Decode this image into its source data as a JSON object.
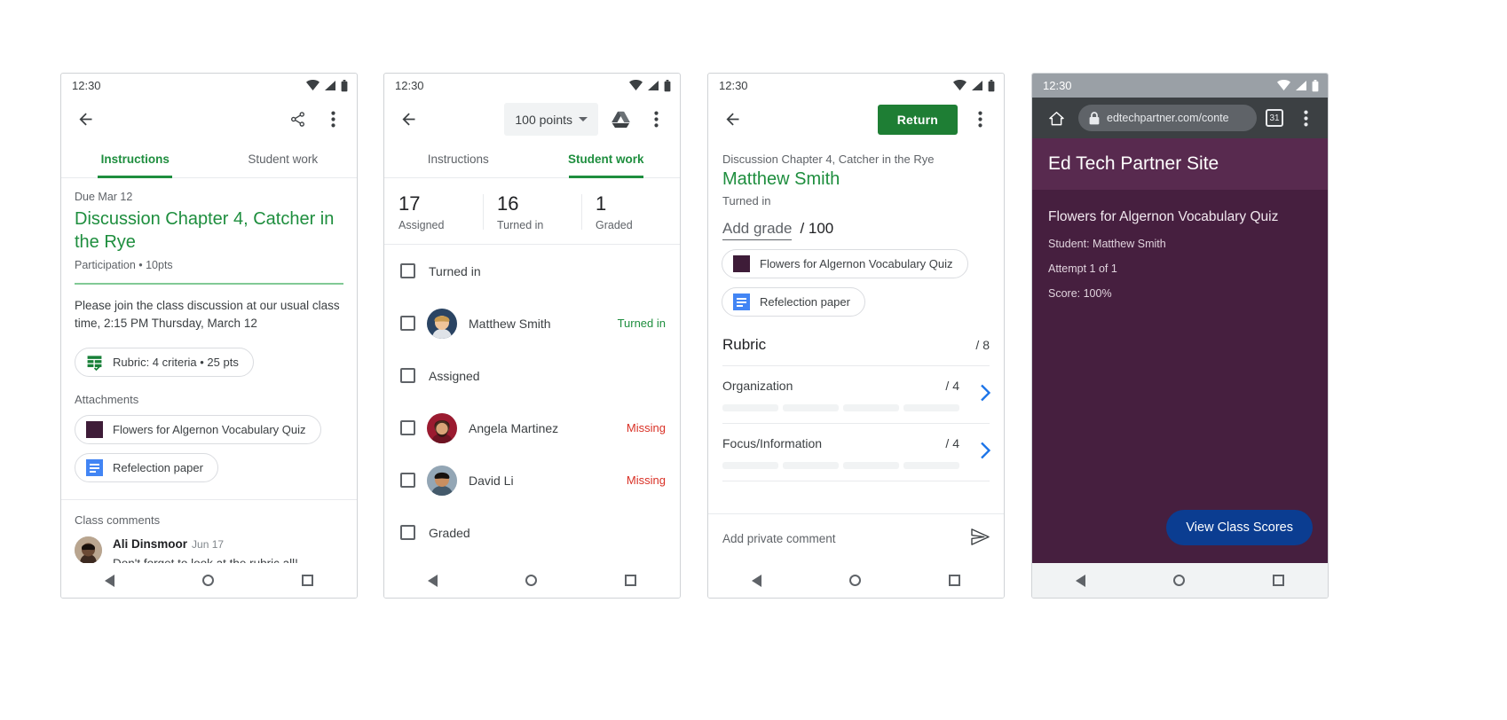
{
  "colors": {
    "green": "#1e8e3e",
    "return_green": "#1e7e34",
    "red": "#d93025",
    "blue_chevron": "#1a73e8",
    "site_purple": "#461f3f",
    "site_header_purple": "#582a4f",
    "button_blue": "#0b3d91",
    "attachment_swatch": "#3e1c38",
    "doc_blue": "#4285f4"
  },
  "status_bar": {
    "time": "12:30"
  },
  "nav_bar": {
    "back": "back-triangle",
    "home": "home-circle",
    "recents": "recents-square"
  },
  "phone1": {
    "appbar": {
      "back_icon": "arrow-back-icon",
      "share_icon": "share-icon",
      "more_icon": "more-vert-icon"
    },
    "tabs": [
      {
        "label": "Instructions",
        "active": true
      },
      {
        "label": "Student work",
        "active": false
      }
    ],
    "due": "Due Mar 12",
    "title": "Discussion Chapter 4, Catcher in the Rye",
    "subtitle": "Participation • 10pts",
    "description": "Please join the class discussion at our usual class time, 2:15 PM Thursday, March 12",
    "rubric_chip": "Rubric: 4 criteria • 25 pts",
    "attachments_label": "Attachments",
    "attachments": [
      {
        "label": "Flowers for Algernon Vocabulary Quiz",
        "icon": "purple-swatch-icon"
      },
      {
        "label": "Refelection paper",
        "icon": "google-docs-icon"
      }
    ],
    "class_comments_label": "Class comments",
    "comment": {
      "author": "Ali Dinsmoor",
      "date": "Jun 17",
      "text": "Don't forget to look at the rubric all!"
    }
  },
  "phone2": {
    "appbar": {
      "back_icon": "arrow-back-icon",
      "points": "100 points",
      "drive_icon": "google-drive-icon",
      "more_icon": "more-vert-icon"
    },
    "tabs": [
      {
        "label": "Instructions",
        "active": false
      },
      {
        "label": "Student work",
        "active": true
      }
    ],
    "stats": [
      {
        "number": "17",
        "label": "Assigned"
      },
      {
        "number": "16",
        "label": "Turned in"
      },
      {
        "number": "1",
        "label": "Graded"
      }
    ],
    "rows": [
      {
        "type": "group",
        "label": "Turned in"
      },
      {
        "type": "student",
        "name": "Matthew Smith",
        "status": "Turned in",
        "status_kind": "turned"
      },
      {
        "type": "group",
        "label": "Assigned"
      },
      {
        "type": "student",
        "name": "Angela Martinez",
        "status": "Missing",
        "status_kind": "missing"
      },
      {
        "type": "student",
        "name": "David Li",
        "status": "Missing",
        "status_kind": "missing"
      },
      {
        "type": "group",
        "label": "Graded"
      }
    ]
  },
  "phone3": {
    "appbar": {
      "back_icon": "arrow-back-icon",
      "return_label": "Return",
      "more_icon": "more-vert-icon"
    },
    "assignment": "Discussion Chapter 4, Catcher in the Rye",
    "student": "Matthew Smith",
    "state": "Turned in",
    "grade_placeholder": "Add grade",
    "grade_max": "/ 100",
    "attachments": [
      {
        "label": "Flowers for Algernon Vocabulary Quiz",
        "icon": "purple-swatch-icon"
      },
      {
        "label": "Refelection paper",
        "icon": "google-docs-icon"
      }
    ],
    "rubric": {
      "title": "Rubric",
      "total": "/ 8",
      "criteria": [
        {
          "name": "Organization",
          "points": "/ 4",
          "levels": 4
        },
        {
          "name": "Focus/Information",
          "points": "/ 4",
          "levels": 4
        }
      ]
    },
    "private_comment_placeholder": "Add private comment",
    "send_icon": "send-icon"
  },
  "phone4": {
    "browser": {
      "home_icon": "home-icon",
      "lock_icon": "lock-icon",
      "url": "edtechpartner.com/conte",
      "tab_count": "31",
      "more_icon": "more-vert-icon"
    },
    "site_name": "Ed Tech Partner Site",
    "quiz_title": "Flowers for Algernon Vocabulary Quiz",
    "details": [
      "Student: Matthew Smith",
      "Attempt 1 of 1",
      "Score: 100%"
    ],
    "cta_label": "View Class Scores"
  }
}
